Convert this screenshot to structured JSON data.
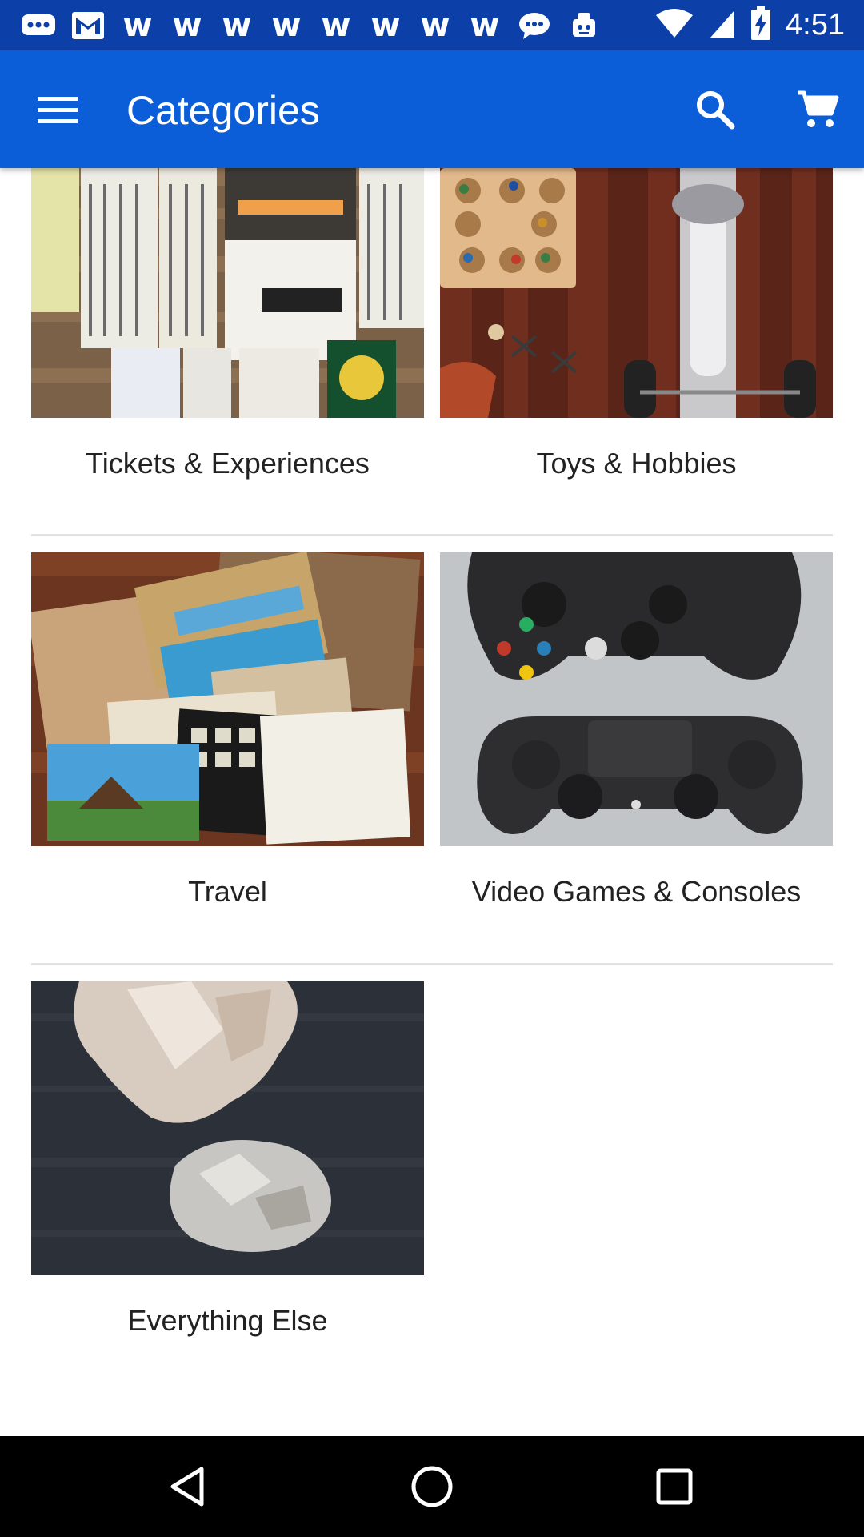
{
  "status_bar": {
    "time": "4:51",
    "left_icons": [
      "chat-bubble-icon",
      "gmail-icon",
      "w-icon",
      "w-icon",
      "w-icon",
      "w-icon",
      "w-icon",
      "w-icon",
      "w-icon",
      "w-icon",
      "messenger-icon",
      "robot-icon"
    ],
    "w_glyph": "w",
    "right_icons": [
      "wifi-icon",
      "cell-signal-icon",
      "battery-charging-icon"
    ]
  },
  "app_bar": {
    "title": "Categories",
    "color": "#0b5ed7"
  },
  "categories": [
    {
      "label": "Tickets & Experiences",
      "image": "tickets-image"
    },
    {
      "label": "Toys & Hobbies",
      "image": "toys-image"
    },
    {
      "label": "Travel",
      "image": "travel-image"
    },
    {
      "label": "Video Games & Consoles",
      "image": "video-games-image"
    },
    {
      "label": "Everything Else",
      "image": "everything-else-image"
    }
  ],
  "nav_bar": {
    "buttons": [
      "back-icon",
      "home-icon",
      "recents-icon"
    ]
  }
}
